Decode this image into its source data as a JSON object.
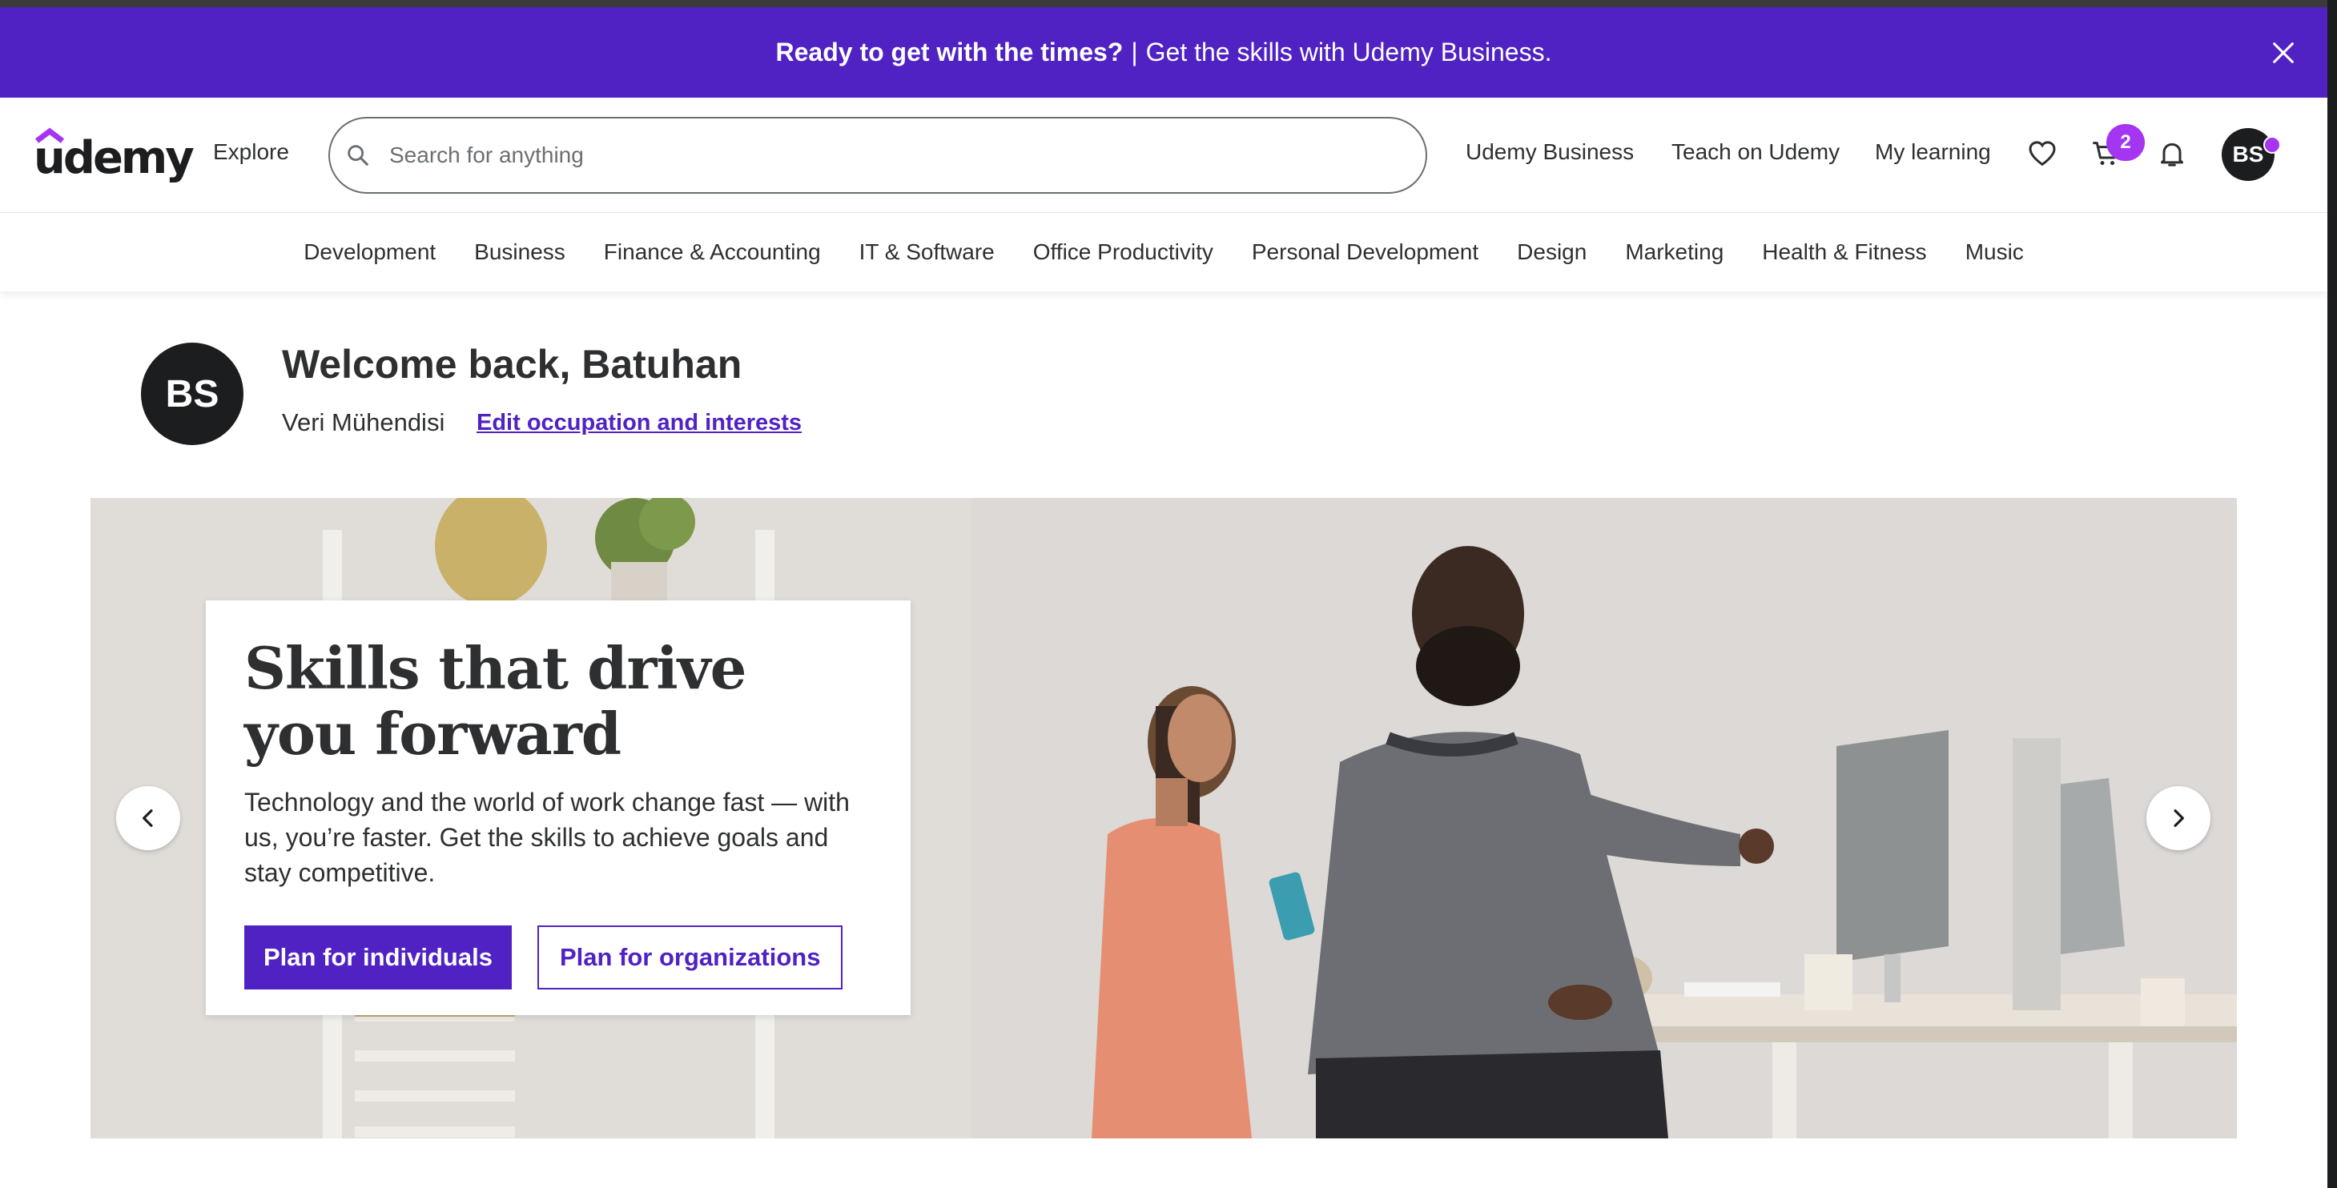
{
  "banner": {
    "bold_text": "Ready to get with the times?",
    "separator": "|",
    "text": "Get the skills with Udemy Business."
  },
  "header": {
    "logo": "udemy",
    "explore": "Explore",
    "search_placeholder": "Search for anything",
    "links": {
      "business": "Udemy Business",
      "teach": "Teach on Udemy",
      "my_learning": "My learning"
    },
    "cart_count": "2",
    "avatar_initials": "BS",
    "accent_color": "#a435f0"
  },
  "categories": [
    "Development",
    "Business",
    "Finance & Accounting",
    "IT & Software",
    "Office Productivity",
    "Personal Development",
    "Design",
    "Marketing",
    "Health & Fitness",
    "Music"
  ],
  "welcome": {
    "initials": "BS",
    "title": "Welcome back, Batuhan",
    "occupation": "Veri Mühendisi",
    "edit_link": "Edit occupation and interests"
  },
  "hero": {
    "title": "Skills that drive you forward",
    "text": "Technology and the world of work change fast — with us, you’re faster. Get the skills to achieve goals and stay competitive.",
    "primary_button": "Plan for individuals",
    "secondary_button": "Plan for organizations"
  },
  "colors": {
    "brand_purple": "#5022c3",
    "accent_purple": "#a435f0",
    "text_dark": "#2d2f31"
  }
}
